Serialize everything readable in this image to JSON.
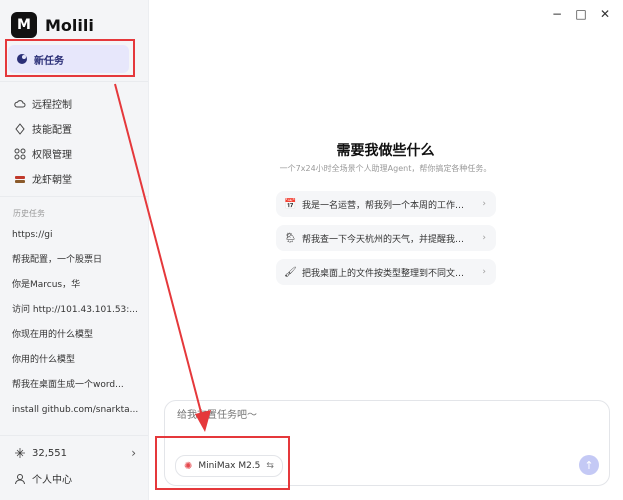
{
  "app": {
    "logo_text": "M",
    "name": "Molili"
  },
  "sidebar": {
    "new_task": "新任务",
    "nav": [
      {
        "label": "远程控制",
        "icon": "cloud-icon"
      },
      {
        "label": "技能配置",
        "icon": "diamond-icon"
      },
      {
        "label": "权限管理",
        "icon": "grid-icon"
      },
      {
        "label": "龙虾朝堂",
        "icon": "lobster-icon"
      }
    ],
    "history_title": "历史任务",
    "history": [
      "https://gi",
      "帮我配置，一个股票日",
      "你是Marcus，华",
      "访问 http://101.43.101.53:...",
      "你现在用的什么模型",
      "你用的什么模型",
      "帮我在桌面生成一个word...",
      "install github.com/snarkta..."
    ],
    "points": "32,551",
    "profile": "个人中心"
  },
  "main": {
    "heading": "需要我做些什么",
    "subheading": "一个7x24小时全场景个人助理Agent，帮你搞定各种任务。",
    "suggestions": [
      {
        "emoji": "📅",
        "text": "我是一名运营，帮我列一个本周的工作计..."
      },
      {
        "emoji": "🌦",
        "text": "帮我查一下今天杭州的天气，并提醒我是..."
      },
      {
        "emoji": "🖌",
        "text": "把我桌面上的文件按类型整理到不同文件..."
      }
    ],
    "input_placeholder": "给我布置任务吧～",
    "model": "MiniMax M2.5"
  },
  "window": {
    "minimize": "−",
    "maximize": "□",
    "close": "✕"
  },
  "colors": {
    "accent": "#e7e7fb",
    "annotation": "#e5383b",
    "send": "#c4c9f5"
  }
}
